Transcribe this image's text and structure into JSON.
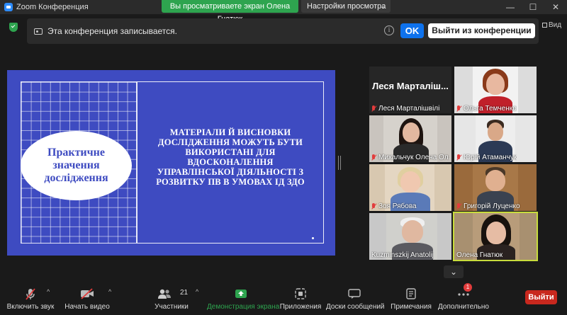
{
  "window": {
    "title": "Zoom Конференция"
  },
  "share_banner": {
    "text": "Вы просматриваете экран Олена Гнатюк"
  },
  "view_options": {
    "label": "Настройки просмотра"
  },
  "recording": {
    "message": "Эта конференция записывается.",
    "ok_label": "OK",
    "leave_label": "Выйти из конференции"
  },
  "view_label": "Вид",
  "slide": {
    "oval_text": "Практичне значення дослідження",
    "main_text": "МАТЕРІАЛИ Й ВИСНОВКИ ДОСЛІДЖЕННЯ МОЖУТЬ БУТИ ВИКОРИСТАНІ ДЛЯ ВДОСКОНАЛЕННЯ УПРАВЛІНСЬКОЇ ДІЯЛЬНОСТІ З РОЗВИТКУ ПВ В УМОВАХ ІД ЗДО"
  },
  "participants": [
    {
      "name": "Леся Марталішвілі",
      "display_text": "Леся Марталіш...",
      "video": false
    },
    {
      "name": "Ольга Темченко",
      "video": true
    },
    {
      "name": "Михальчук Олена Ол...",
      "video": true
    },
    {
      "name": "Юрій Атаманчук",
      "video": true
    },
    {
      "name": "Зоя Рябова",
      "video": true
    },
    {
      "name": "Григорій Луценко",
      "video": true
    },
    {
      "name": "Kuzminszkij Anatolij",
      "video": true
    },
    {
      "name": "Олена Гнатюк",
      "video": true,
      "active_speaker": true
    }
  ],
  "toolbar": {
    "unmute_label": "Включить звук",
    "start_video_label": "Начать видео",
    "participants_label": "Участники",
    "participants_count": "21",
    "share_label": "Демонстрация экрана",
    "apps_label": "Приложения",
    "chat_label": "Доски сообщений",
    "notes_label": "Примечания",
    "more_label": "Дополнительно",
    "more_badge": "1",
    "exit_label": "Выйти"
  },
  "colors": {
    "share_green": "#2ea44f",
    "ok_blue": "#0e72ed",
    "slide_blue": "#3e4bc1",
    "exit_red": "#c8281e",
    "active_border": "#c8dc3c",
    "muted_red": "#e23c3c"
  }
}
